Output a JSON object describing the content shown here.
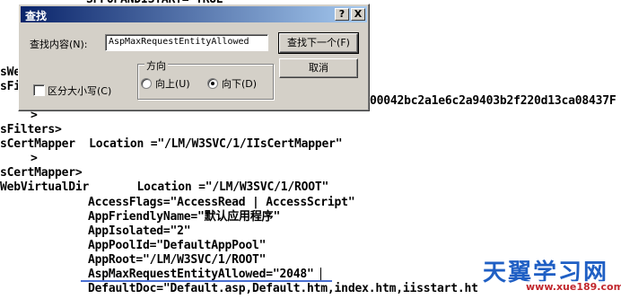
{
  "editor": {
    "lines": [
      "SPFOPANDISTART= TRUE",
      "sWe",
      "sFil",
      "00042bc2a1e6c2a9403b2f220d13ca08437F",
      ">",
      "sFilters>",
      "sCertMapper  Location =\"/LM/W3SVC/1/IIsCertMapper\"",
      ">",
      "sCertMapper>",
      "WebVirtualDir       Location =\"/LM/W3SVC/1/ROOT\"",
      "AccessFlags=\"AccessRead | AccessScript\"",
      "AppFriendlyName=\"默认应用程序\"",
      "AppIsolated=\"2\"",
      "AppPoolId=\"DefaultAppPool\"",
      "AppRoot=\"/LM/W3SVC/1/ROOT\"",
      "AspMaxRequestEntityAllowed=\"2048\"",
      "DefaultDoc=\"Default.asp,Default.htm,index.htm,iisstart.ht"
    ]
  },
  "dialog": {
    "title": "查找",
    "help_button": "?",
    "close_button": "X",
    "find_what_label": "查找内容(N):",
    "find_what_value": "AspMaxRequestEntityAllowed",
    "find_next_label": "查找下一个(F)",
    "cancel_label": "取消",
    "match_case_label": "区分大小写(C)",
    "match_case_checked": false,
    "direction_label": "方向",
    "direction_up_label": "向上(U)",
    "direction_down_label": "向下(D)",
    "direction_selected": "down"
  },
  "watermark": {
    "main": "天翼学习网",
    "sub": "www.xue189.com"
  }
}
